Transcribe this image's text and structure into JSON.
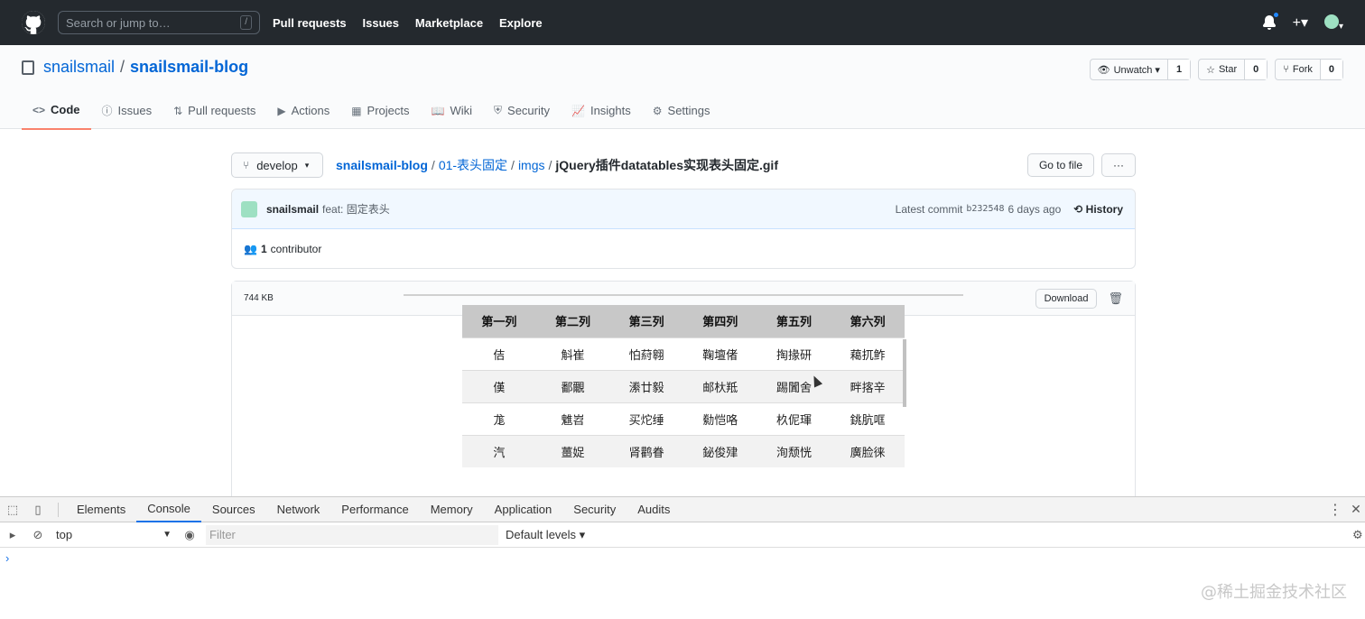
{
  "header": {
    "search_placeholder": "Search or jump to…",
    "search_key": "/",
    "nav": [
      "Pull requests",
      "Issues",
      "Marketplace",
      "Explore"
    ],
    "plus": "+▾"
  },
  "repo": {
    "owner": "snailsmail",
    "separator": "/",
    "name": "snailsmail-blog",
    "watch_label": "Unwatch ▾",
    "watch_count": "1",
    "star_label": "Star",
    "star_count": "0",
    "fork_label": "Fork",
    "fork_count": "0",
    "tabs": [
      {
        "icon": "<>",
        "label": "Code"
      },
      {
        "icon": "ⓘ",
        "label": "Issues"
      },
      {
        "icon": "⇅",
        "label": "Pull requests"
      },
      {
        "icon": "▶",
        "label": "Actions"
      },
      {
        "icon": "▦",
        "label": "Projects"
      },
      {
        "icon": "📖",
        "label": "Wiki"
      },
      {
        "icon": "⛨",
        "label": "Security"
      },
      {
        "icon": "📈",
        "label": "Insights"
      },
      {
        "icon": "⚙",
        "label": "Settings"
      }
    ]
  },
  "file_nav": {
    "branch": "develop",
    "crumbs": [
      "snailsmail-blog",
      "01-表头固定",
      "imgs"
    ],
    "filename": "jQuery插件datatables实现表头固定.gif",
    "go_to_file": "Go to file",
    "more": "···"
  },
  "commit": {
    "author": "snailsmail",
    "message": "feat: 固定表头",
    "latest_label": "Latest commit",
    "sha": "b232548",
    "age": "6 days ago",
    "history": "History",
    "contributors_count": "1",
    "contributors_label": "contributor"
  },
  "blob": {
    "size": "744 KB",
    "download": "Download"
  },
  "gif_table": {
    "headers": [
      "第一列",
      "第二列",
      "第三列",
      "第四列",
      "第五列",
      "第六列"
    ],
    "rows": [
      [
        "佶",
        "斛崔",
        "怕葤翱",
        "鞠壇偖",
        "掏掾研",
        "藒扤鲊"
      ],
      [
        "傼",
        "鄱覼",
        "潫廿毅",
        "邮杕羝",
        "踢闐舍",
        "畔揢辛"
      ],
      [
        "尨",
        "魋岧",
        "买炨缍",
        "勬恺咯",
        "杦伲琿",
        "銚肮哐"
      ],
      [
        "汽",
        "薑娖",
        "肾鹳眷",
        "鉍俊肂",
        "洵颓恍",
        "廣脸徕"
      ]
    ]
  },
  "devtools": {
    "tabs": [
      "Elements",
      "Console",
      "Sources",
      "Network",
      "Performance",
      "Memory",
      "Application",
      "Security",
      "Audits"
    ],
    "context": "top",
    "filter_placeholder": "Filter",
    "levels": "Default levels ▾",
    "prompt": "›"
  },
  "watermark": "@稀土掘金技术社区"
}
